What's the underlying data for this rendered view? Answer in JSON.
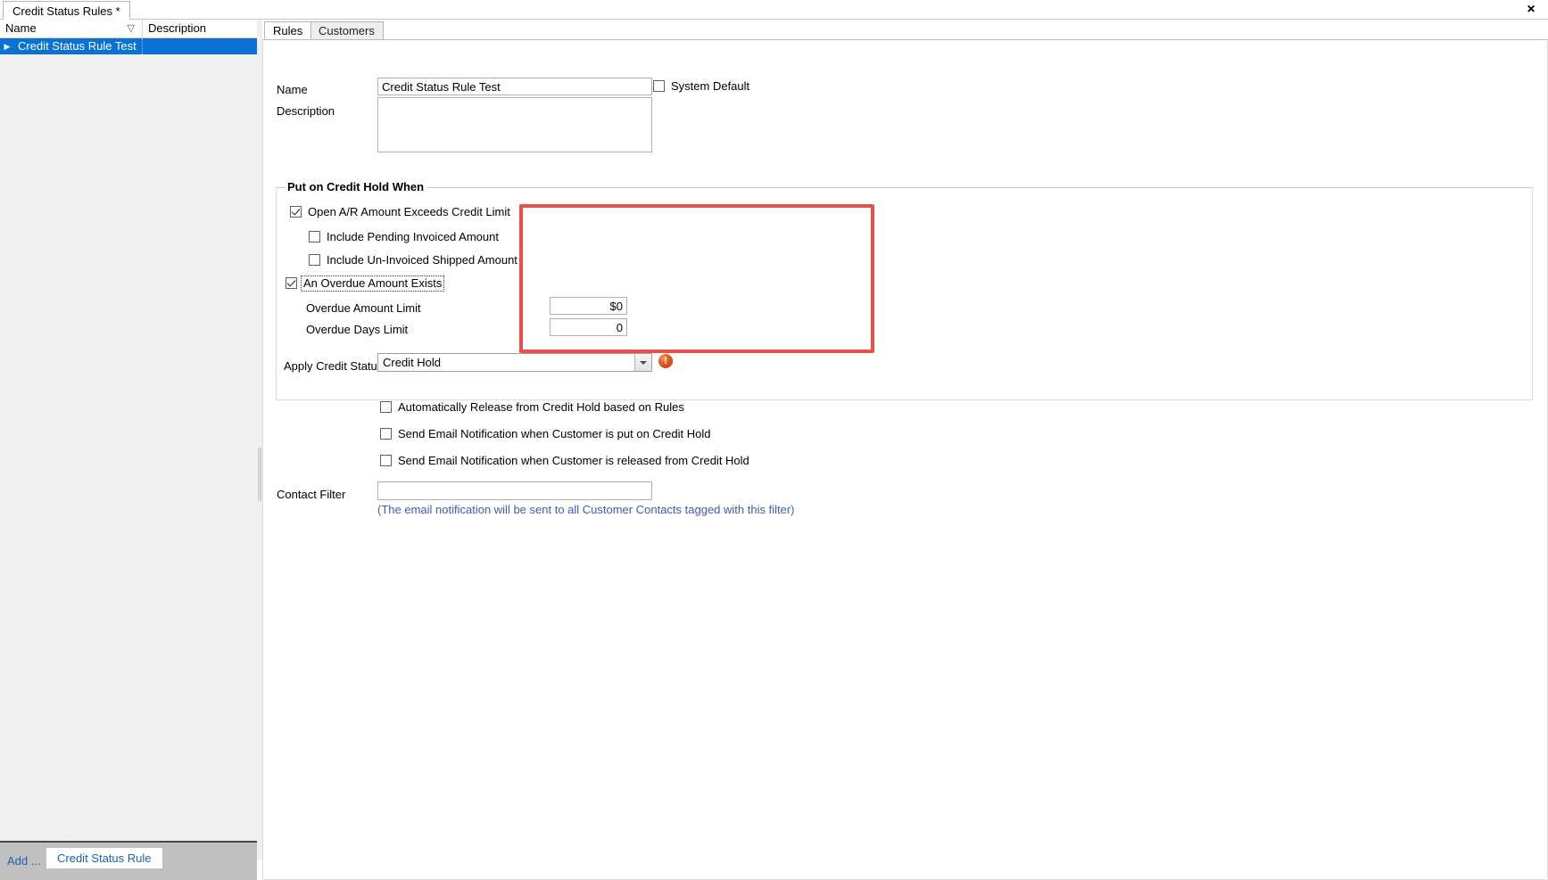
{
  "window": {
    "tab_label": "Credit Status Rules *",
    "close_icon": "×"
  },
  "left_panel": {
    "columns": [
      {
        "label": "Name",
        "sort_icon": "▽"
      },
      {
        "label": "Description"
      }
    ],
    "rows": [
      {
        "row_arrow": "▶",
        "name": "Credit Status Rule Test",
        "description": ""
      }
    ],
    "actions": {
      "add_link": "Add ...",
      "add_button": "Credit Status Rule"
    }
  },
  "detail": {
    "tabs": [
      {
        "label": "Rules",
        "active": true
      },
      {
        "label": "Customers",
        "active": false
      }
    ],
    "fields": {
      "name_label": "Name",
      "name_value": "Credit Status Rule Test",
      "description_label": "Description",
      "description_value": "",
      "system_default_label": "System Default",
      "system_default_checked": false
    },
    "group": {
      "title": "Put on Credit Hold When",
      "rules": [
        {
          "label": "Open A/R Amount Exceeds Credit Limit",
          "checked": true
        },
        {
          "label": "Include Pending Invoiced Amount",
          "checked": false
        },
        {
          "label": "Include Un-Invoiced Shipped Amount",
          "checked": false
        },
        {
          "label": "An Overdue Amount Exists",
          "checked": true,
          "focused": true
        }
      ],
      "overdue_amount_label": "Overdue Amount Limit",
      "overdue_amount_value": "$0",
      "overdue_days_label": "Overdue Days Limit",
      "overdue_days_value": "0"
    },
    "apply_status": {
      "label": "Apply Credit Status",
      "value": "Credit Hold",
      "options": [
        "Credit Hold"
      ],
      "error_icon": "!",
      "error_color": "#e3571f"
    },
    "options": [
      {
        "label": "Automatically Release from Credit Hold based on Rules",
        "checked": false
      },
      {
        "label": "Send Email Notification when Customer is put on Credit Hold",
        "checked": false
      },
      {
        "label": "Send Email Notification when Customer is released from Credit Hold",
        "checked": false
      }
    ],
    "contact_filter": {
      "label": "Contact Filter",
      "value": "",
      "placeholder": "",
      "hint": "(The email notification will be sent to all Customer Contacts tagged with this filter)",
      "hint_color": "#3b5fb0"
    }
  },
  "colors": {
    "selection_blue": "#0a72d4",
    "annotation_red": "#e8514a",
    "link_blue": "#1764b0"
  }
}
